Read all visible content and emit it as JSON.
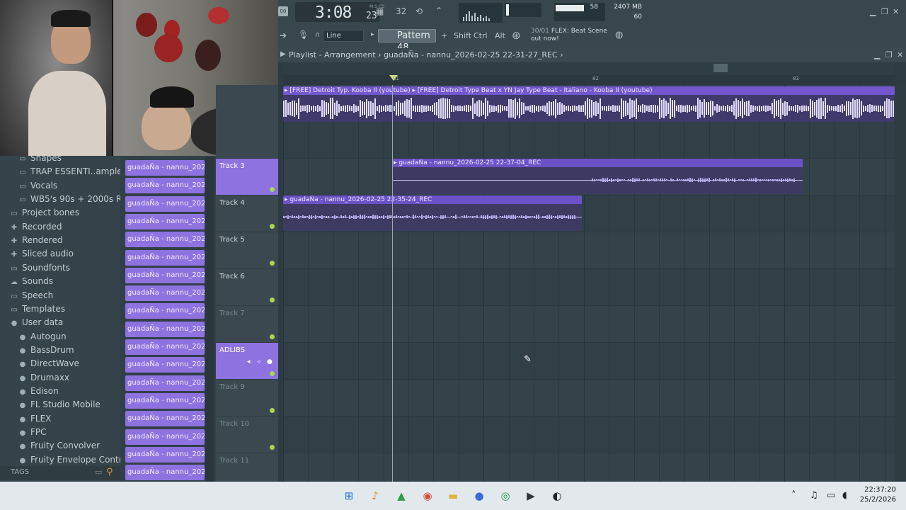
{
  "toolbar": {
    "time_main": "3:08",
    "time_sub": "23",
    "time_label": "M:S:CS",
    "cpu_value": "58",
    "mem_value": "2407 MB",
    "polyphony": "60",
    "snap": "Line",
    "pattern": "Pattern 48",
    "pattern_add": "+",
    "shift": "Shift",
    "ctrl": "Ctrl",
    "alt": "Alt",
    "news_date": "30/01",
    "news_text": "FLEX: Beat Scene out now!",
    "tempo_glyph": "32",
    "win_minimize": "▁",
    "win_restore": "❐",
    "win_close": "✕"
  },
  "playlist": {
    "title": "Playlist - Arrangement",
    "separator": "›",
    "project": "guadaÑa - nannu_2026-02-25 22-31-27_REC",
    "ruler_marks": [
      "81",
      "82",
      "83"
    ],
    "beat_clip_label": "▸ [FREE] Detroit Typ. Kooba II (youtube) ▸ [FREE] Detroit Type Beat x YN Jay Type Beat - Italiano - Kooba II (youtube)",
    "clip_rec_1": "▸ guadaÑa - nannu_2026-02-25 22-37-04_REC",
    "clip_rec_2": "▸ guadaÑa - nannu_2026-02-25 22-35-24_REC"
  },
  "tracks": [
    {
      "name": "Track 3",
      "selected": true
    },
    {
      "name": "Track 4"
    },
    {
      "name": "Track 5"
    },
    {
      "name": "Track 6"
    },
    {
      "name": "Track 7",
      "dim": true
    },
    {
      "name": "ADLIBS",
      "selected": true
    },
    {
      "name": "Track 9",
      "dim": true
    },
    {
      "name": "Track 10",
      "dim": true
    },
    {
      "name": "Track 11",
      "dim": true
    }
  ],
  "browser": {
    "items": [
      {
        "label": "Shapes",
        "icon": "folder-icon"
      },
      {
        "label": "TRAP ESSENTI..ample Pack]",
        "icon": "folder-icon"
      },
      {
        "label": "Vocals",
        "icon": "folder-icon"
      },
      {
        "label": "WB5's 90s + 2000s RnB Kit",
        "icon": "folder-icon"
      },
      {
        "label": "Project bones",
        "icon": "folder-icon"
      },
      {
        "label": "Recorded",
        "icon": "plus-icon"
      },
      {
        "label": "Rendered",
        "icon": "plus-icon"
      },
      {
        "label": "Sliced audio",
        "icon": "plus-icon"
      },
      {
        "label": "Soundfonts",
        "icon": "folder-icon"
      },
      {
        "label": "Sounds",
        "icon": "cloud-icon"
      },
      {
        "label": "Speech",
        "icon": "folder-icon"
      },
      {
        "label": "Templates",
        "icon": "folder-icon"
      },
      {
        "label": "User data",
        "icon": "user-icon"
      },
      {
        "label": "Autogun",
        "icon": "user-icon"
      },
      {
        "label": "BassDrum",
        "icon": "user-icon"
      },
      {
        "label": "DirectWave",
        "icon": "user-icon"
      },
      {
        "label": "Drumaxx",
        "icon": "user-icon"
      },
      {
        "label": "Edison",
        "icon": "user-icon"
      },
      {
        "label": "FL Studio Mobile",
        "icon": "user-icon"
      },
      {
        "label": "FLEX",
        "icon": "user-icon"
      },
      {
        "label": "FPC",
        "icon": "user-icon"
      },
      {
        "label": "Fruity Convolver",
        "icon": "user-icon"
      },
      {
        "label": "Fruity Envelope Controller",
        "icon": "user-icon"
      }
    ],
    "tags_label": "TAGS"
  },
  "picker": {
    "clip_label": "guadaÑa - nannu_2026-...",
    "count": 18
  },
  "taskbar": {
    "time": "22:37:20",
    "date": "25/2/2026"
  },
  "colors": {
    "accent_purple": "#8e72e0",
    "led_green": "#a8d84e",
    "background": "#2d3b42"
  }
}
